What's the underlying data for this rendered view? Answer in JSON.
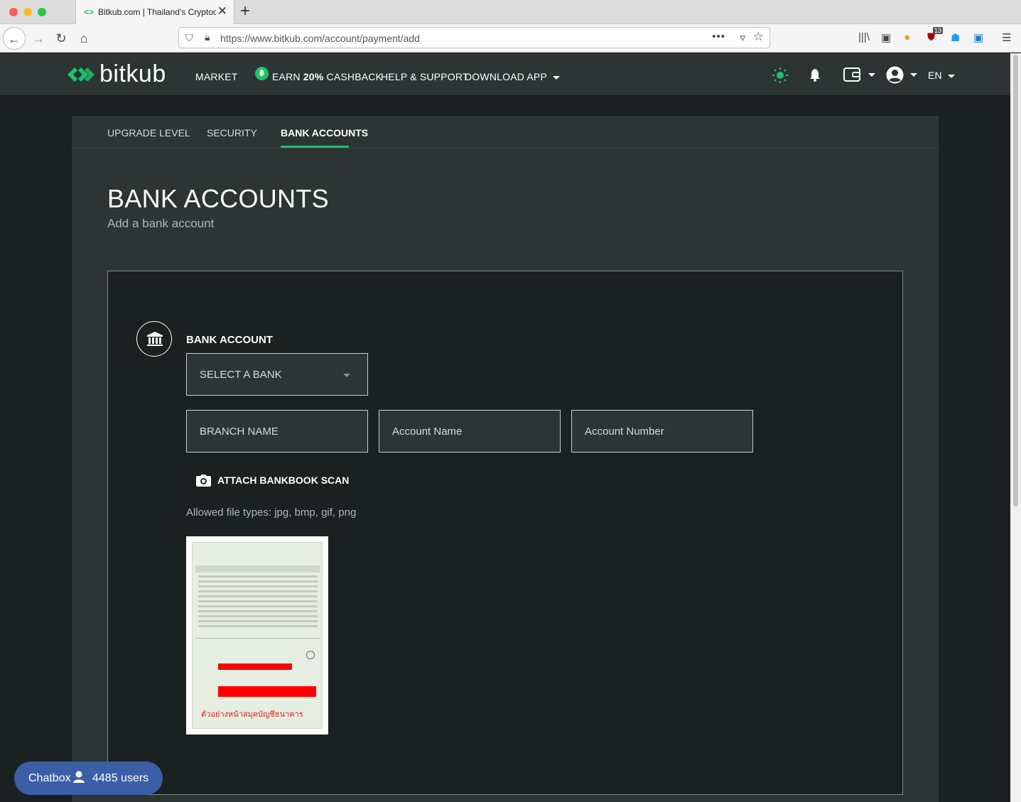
{
  "browser": {
    "tab_title": "Bitkub.com | Thailand's Cryptoc",
    "url": "https://www.bitkub.com/account/payment/add",
    "extension_badge": "13"
  },
  "header": {
    "logo_text": "bitkub",
    "menu": {
      "market": "MARKET",
      "earn_prefix": "EARN ",
      "earn_highlight": "20%",
      "earn_suffix": " CASHBACK",
      "help": "HELP & SUPPORT",
      "download": "DOWNLOAD APP"
    },
    "language": "EN",
    "coin_symbol": "฿"
  },
  "subtabs": {
    "upgrade": "UPGRADE LEVEL",
    "security": "SECURITY",
    "bank_accounts": "BANK ACCOUNTS"
  },
  "page": {
    "title": "BANK ACCOUNTS",
    "subtitle": "Add a bank account"
  },
  "form": {
    "section_label": "BANK ACCOUNT",
    "select_bank": "SELECT A BANK",
    "branch_placeholder": "BRANCH NAME",
    "account_name_placeholder": "Account Name",
    "account_number_placeholder": "Account Number",
    "attach_label": "ATTACH BANKBOOK SCAN",
    "allowed_types": "Allowed file types: jpg, bmp, gif, png",
    "preview_caption": "ตัวอย่างหน้าสมุดบัญชีธนาคาร"
  },
  "chatbox": {
    "label": "Chatbox",
    "users": "4485 users"
  },
  "colors": {
    "accent": "#1fc26a",
    "header_bg": "#2c3434",
    "page_bg": "#1b2020",
    "chat_bg": "#3b5fa6"
  }
}
